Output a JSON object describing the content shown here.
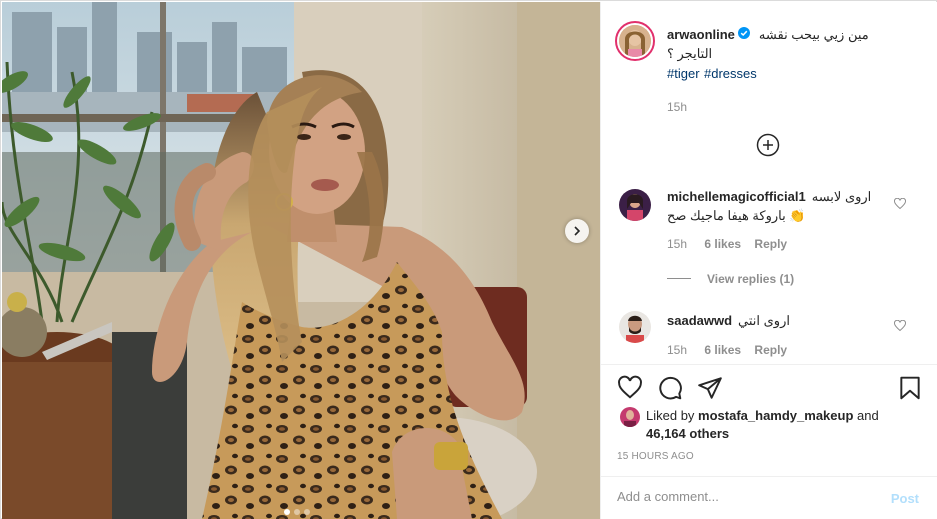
{
  "post": {
    "username": "arwaonline",
    "caption_line1": "مين زيي بيحب نقشه",
    "caption_line2": "التايجر ؟",
    "hashtags": [
      "#tiger",
      "#dresses"
    ],
    "time": "15h",
    "load_more_icon": "plus-circle-icon"
  },
  "comments": [
    {
      "username": "michellemagicofficial1",
      "text_line1": "اروى لابسه",
      "text_line2": "باروكة هيفا ماجيك صح",
      "emoji": "👏",
      "time": "15h",
      "likes": "6 likes",
      "reply": "Reply",
      "view_replies": "View replies (1)"
    },
    {
      "username": "saadawwd",
      "text_line1": "اروى انتي",
      "time": "15h",
      "likes": "6 likes",
      "reply": "Reply"
    }
  ],
  "actions": {
    "icons": [
      "heart-icon",
      "comment-icon",
      "share-icon",
      "bookmark-icon"
    ]
  },
  "likes": {
    "prefix": "Liked by",
    "user": "mostafa_hamdy_makeup",
    "and": "and",
    "count": "46,164 others"
  },
  "timestamp": "15 HOURS AGO",
  "comment_box": {
    "placeholder": "Add a comment...",
    "post_label": "Post"
  },
  "carousel": {
    "total": 3,
    "active": 0
  },
  "colors": {
    "link": "#00376b",
    "post_disabled": "#b2dffc",
    "verified": "#0095f6",
    "secondary_text": "#8e8e8e"
  }
}
